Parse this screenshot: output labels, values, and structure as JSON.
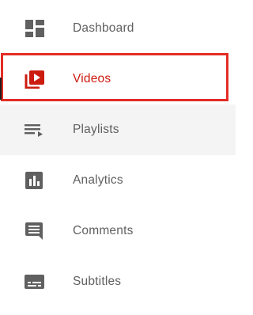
{
  "nav": {
    "items": [
      {
        "label": "Dashboard",
        "icon": "dashboard-icon",
        "state": "default"
      },
      {
        "label": "Videos",
        "icon": "videos-icon",
        "state": "active"
      },
      {
        "label": "Playlists",
        "icon": "playlists-icon",
        "state": "hovered"
      },
      {
        "label": "Analytics",
        "icon": "analytics-icon",
        "state": "default"
      },
      {
        "label": "Comments",
        "icon": "comments-icon",
        "state": "default"
      },
      {
        "label": "Subtitles",
        "icon": "subtitles-icon",
        "state": "default"
      }
    ]
  },
  "colors": {
    "icon": "#606060",
    "active": "#cc1b0f",
    "highlight_box": "#e22c25",
    "hover_background": "#f4f4f4",
    "label": "#606060"
  }
}
